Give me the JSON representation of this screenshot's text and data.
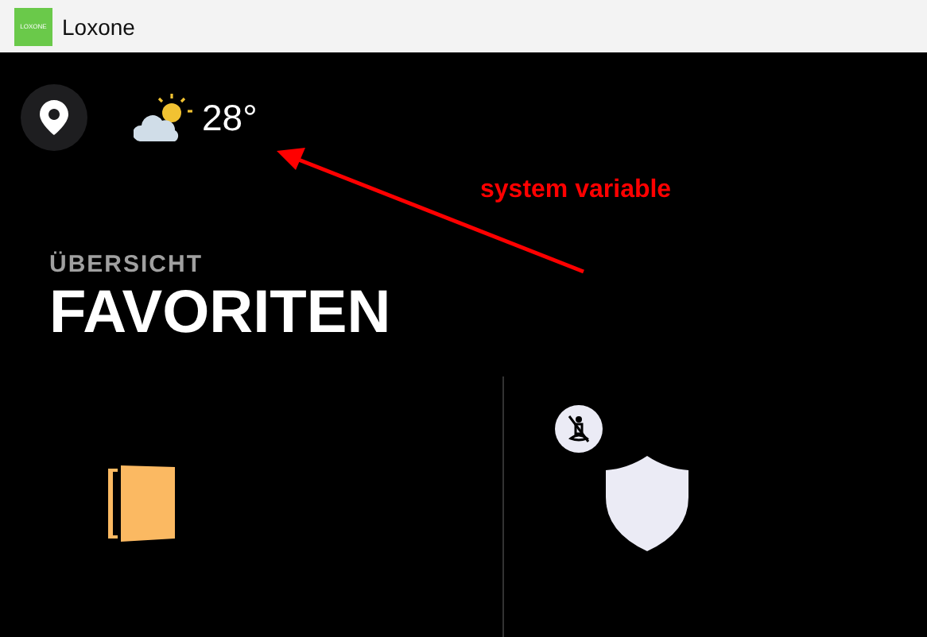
{
  "window": {
    "title": "Loxone",
    "icon_text": "LOXONE"
  },
  "header": {
    "temperature": "28°"
  },
  "annotation": {
    "text": "system variable"
  },
  "page": {
    "subtitle": "ÜBERSICHT",
    "title": "FAVORITEN"
  },
  "tiles": [
    {
      "kind": "door"
    },
    {
      "kind": "alarm",
      "badge": true
    }
  ]
}
